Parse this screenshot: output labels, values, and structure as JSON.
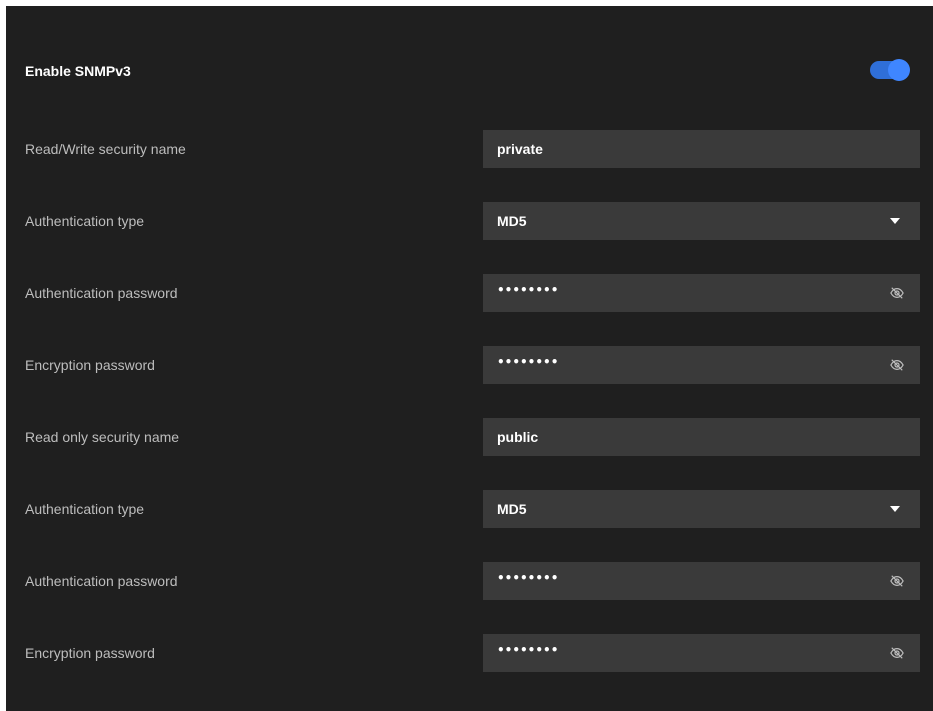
{
  "header": {
    "label": "Enable SNMPv3",
    "toggle_on": true
  },
  "rows": [
    {
      "label": "Read/Write security name",
      "value": "private"
    },
    {
      "label": "Authentication type",
      "value": "MD5"
    },
    {
      "label": "Authentication password",
      "value": "••••••••"
    },
    {
      "label": "Encryption password",
      "value": "••••••••"
    },
    {
      "label": "Read only security name",
      "value": "public"
    },
    {
      "label": "Authentication type",
      "value": "MD5"
    },
    {
      "label": "Authentication password",
      "value": "••••••••"
    },
    {
      "label": "Encryption password",
      "value": "••••••••"
    }
  ],
  "icons": {
    "dropdown": "chevron-down-icon",
    "password_visibility": "eye-slash-icon"
  },
  "colors": {
    "background": "#1f1f1f",
    "field": "#3a3a3a",
    "accent": "#3f86ff"
  }
}
